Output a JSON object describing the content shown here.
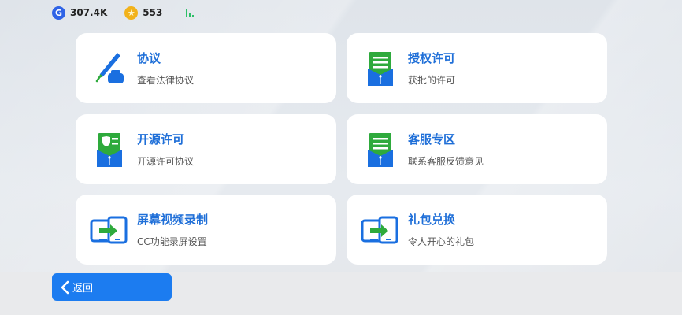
{
  "topbar": {
    "g_coin_symbol": "G",
    "g_coin_value": "307.4K",
    "star_coin_symbol": "★",
    "star_coin_value": "553"
  },
  "cards": [
    {
      "title": "协议",
      "subtitle": "查看法律协议",
      "icon": "pen-icon"
    },
    {
      "title": "授权许可",
      "subtitle": "获批的许可",
      "icon": "document-icon"
    },
    {
      "title": "开源许可",
      "subtitle": "开源许可协议",
      "icon": "certificate-icon"
    },
    {
      "title": "客服专区",
      "subtitle": "联系客服反馈意见",
      "icon": "document-icon"
    },
    {
      "title": "屏幕视频录制",
      "subtitle": "CC功能录屏设置",
      "icon": "screen-transfer-icon"
    },
    {
      "title": "礼包兑换",
      "subtitle": "令人开心的礼包",
      "icon": "screen-transfer-icon"
    }
  ],
  "back_button": {
    "label": "返回"
  },
  "colors": {
    "accent": "#1c7cf0",
    "title_blue": "#1f6fd8",
    "icon_green": "#2eaa3c",
    "icon_blue": "#1a6fe0"
  }
}
